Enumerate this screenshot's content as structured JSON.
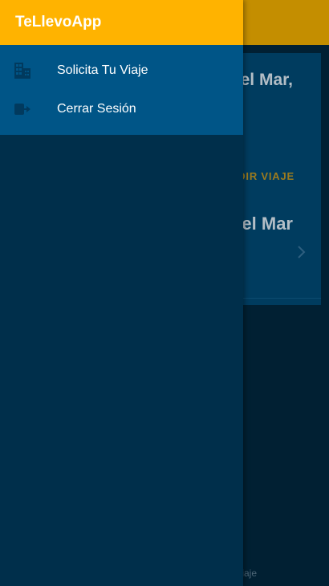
{
  "app": {
    "title": "TeLlevoApp",
    "accent_color": "#ffb300",
    "menu_color": "#005587",
    "drawer_color": "#002f4b"
  },
  "drawer": {
    "items": [
      {
        "label": "Solicita Tu Viaje",
        "icon": "building-icon"
      },
      {
        "label": "Cerrar Sesión",
        "icon": "logout-icon"
      }
    ]
  },
  "background": {
    "card_title": "el Mar,",
    "card_action": "DIR VIAJE",
    "card_title_2": "el Mar",
    "bottom_label": "iaje"
  }
}
